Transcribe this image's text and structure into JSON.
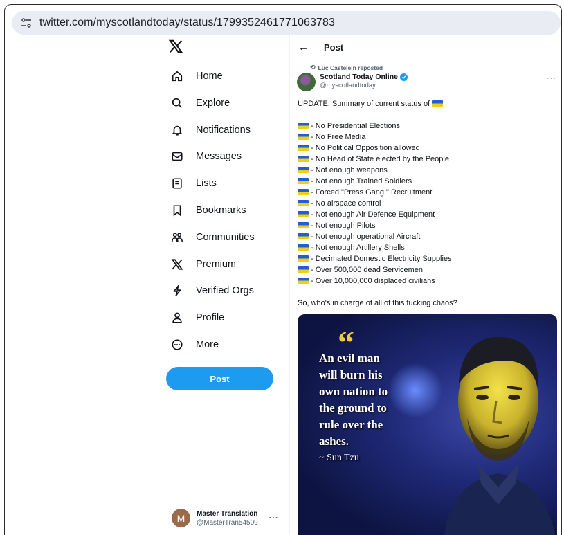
{
  "browser": {
    "url": "twitter.com/myscotlandtoday/status/1799352461771063783"
  },
  "nav": {
    "items": [
      {
        "label": "Home",
        "icon": "home-icon"
      },
      {
        "label": "Explore",
        "icon": "search-icon"
      },
      {
        "label": "Notifications",
        "icon": "bell-icon"
      },
      {
        "label": "Messages",
        "icon": "envelope-icon"
      },
      {
        "label": "Lists",
        "icon": "list-icon"
      },
      {
        "label": "Bookmarks",
        "icon": "bookmark-icon"
      },
      {
        "label": "Communities",
        "icon": "people-icon"
      },
      {
        "label": "Premium",
        "icon": "x-icon"
      },
      {
        "label": "Verified Orgs",
        "icon": "lightning-icon"
      },
      {
        "label": "Profile",
        "icon": "person-icon"
      },
      {
        "label": "More",
        "icon": "more-circle-icon"
      }
    ],
    "post_label": "Post"
  },
  "account": {
    "initial": "M",
    "name": "Master Translation",
    "handle": "@MasterTran54509",
    "more": "···"
  },
  "header": {
    "title": "Post"
  },
  "post": {
    "repost_text": "Luc Castelein reposted",
    "author_name": "Scotland Today Online",
    "author_handle": "@myscotlandtoday",
    "more": "···",
    "intro": "UPDATE:  Summary of current status of",
    "lines": [
      "- No Presidential Elections",
      "- No Free Media",
      "- No Political Opposition allowed",
      "- No Head of State elected by the People",
      "- Not enough weapons",
      "- Not enough Trained Soldiers",
      "- Forced \"Press Gang,\" Recruitment",
      "- No airspace control",
      "- Not enough Air Defence Equipment",
      "- Not enough Pilots",
      "- Not enough operational Aircraft",
      "- Not enough Artillery Shells",
      "- Decimated Domestic Electricity Supplies",
      "- Over 500,000 dead Servicemen",
      "- Over 10,000,000 displaced civilians"
    ],
    "closing": "So, who's in charge of all of this fucking chaos?",
    "image": {
      "quote_lines": [
        "An evil man",
        "will burn his",
        "own nation to",
        "the ground to",
        "rule over the",
        "ashes."
      ],
      "attribution": "~ Sun Tzu"
    }
  },
  "colors": {
    "accent": "#1d9bf0",
    "text": "#0f1419",
    "muted": "#536471",
    "flag_blue": "#1f5fd0",
    "flag_yellow": "#f3cc18"
  }
}
